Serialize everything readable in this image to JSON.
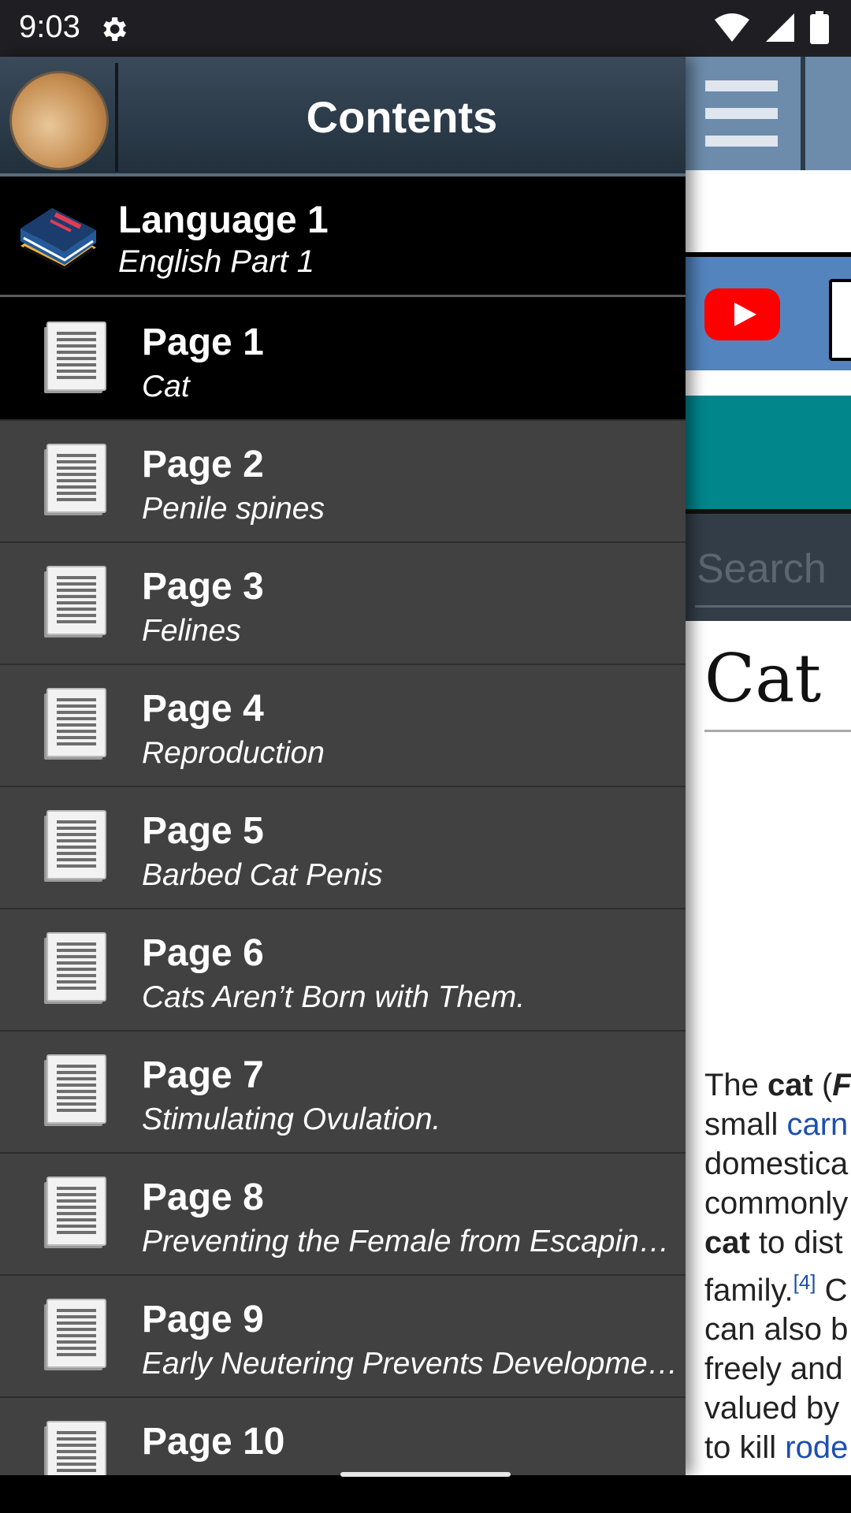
{
  "status_bar": {
    "time": "9:03",
    "icons": [
      "gear-icon",
      "wifi-icon",
      "signal-icon",
      "battery-icon"
    ]
  },
  "drawer": {
    "title": "Contents",
    "section": {
      "title": "Language 1",
      "subtitle": "English Part 1"
    },
    "pages": [
      {
        "title": "Page 1",
        "subtitle": "Cat",
        "selected": true
      },
      {
        "title": "Page 2",
        "subtitle": "Penile spines"
      },
      {
        "title": "Page 3",
        "subtitle": "Felines"
      },
      {
        "title": "Page 4",
        "subtitle": "Reproduction"
      },
      {
        "title": "Page 5",
        "subtitle": "Barbed Cat Penis"
      },
      {
        "title": "Page 6",
        "subtitle": "Cats Aren’t Born with Them."
      },
      {
        "title": "Page 7",
        "subtitle": "Stimulating Ovulation."
      },
      {
        "title": "Page 8",
        "subtitle": "Preventing the Female from Escapin…"
      },
      {
        "title": "Page 9",
        "subtitle": "Early Neutering Prevents Developme…"
      },
      {
        "title": "Page 10",
        "subtitle": ""
      }
    ]
  },
  "content": {
    "search_placeholder": "Search",
    "article_title": "Cat",
    "body_lines": [
      [
        "The ",
        "cat",
        " (",
        "F"
      ],
      [
        "small ",
        "carn"
      ],
      [
        "domestica"
      ],
      [
        "commonly"
      ],
      [
        "cat",
        " to dist"
      ],
      [
        "family.",
        "[4]",
        " C"
      ],
      [
        "can also b"
      ],
      [
        "freely and"
      ],
      [
        "valued by"
      ],
      [
        "to kill ",
        "rode"
      ]
    ]
  },
  "colors": {
    "drawer_bg": "#414142",
    "selected_bg": "#000000",
    "header_bg": "#2c3a49",
    "menu_button": "#6d8cab",
    "teal_bar": "#00868b",
    "media_bar": "#5384be",
    "link": "#1c4fb0"
  }
}
